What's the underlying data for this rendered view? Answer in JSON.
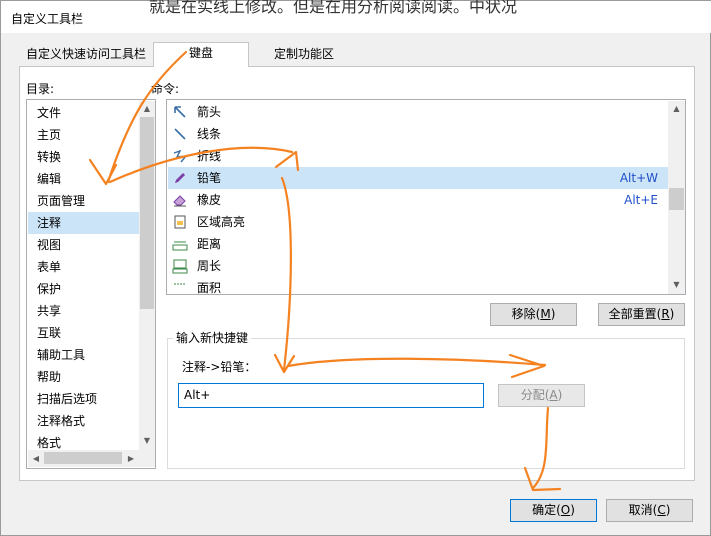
{
  "window": {
    "title": "自定义工具栏",
    "background_text": "就是在实线上修改。但是在用分析阅读阅读。中状况"
  },
  "tabs": [
    {
      "label": "自定义快速访问工具栏",
      "active": false
    },
    {
      "label": "键盘",
      "active": true
    },
    {
      "label": "定制功能区",
      "active": false
    }
  ],
  "directory": {
    "label": "目录:",
    "items": [
      "文件",
      "主页",
      "转换",
      "编辑",
      "页面管理",
      "注释",
      "视图",
      "表单",
      "保护",
      "共享",
      "互联",
      "辅助工具",
      "帮助",
      "扫描后选项",
      "注释格式",
      "格式"
    ],
    "selected": "注释"
  },
  "commands": {
    "label": "命令:",
    "items": [
      {
        "label": "箭头",
        "shortcut": "",
        "icon": "arrow-icon"
      },
      {
        "label": "线条",
        "shortcut": "",
        "icon": "line-icon"
      },
      {
        "label": "折线",
        "shortcut": "",
        "icon": "polyline-icon"
      },
      {
        "label": "铅笔",
        "shortcut": "Alt+W",
        "icon": "pencil-icon"
      },
      {
        "label": "橡皮",
        "shortcut": "Alt+E",
        "icon": "eraser-icon"
      },
      {
        "label": "区域高亮",
        "shortcut": "",
        "icon": "area-highlight-icon"
      },
      {
        "label": "距离",
        "shortcut": "",
        "icon": "distance-icon"
      },
      {
        "label": "周长",
        "shortcut": "",
        "icon": "perimeter-icon"
      },
      {
        "label": "面积",
        "shortcut": "",
        "icon": "area-icon"
      }
    ],
    "selected": "铅笔"
  },
  "buttons": {
    "remove": {
      "label": "移除",
      "mnemonic": "M"
    },
    "reset_all": {
      "label": "全部重置",
      "mnemonic": "R"
    },
    "assign": {
      "label": "分配",
      "mnemonic": "A"
    },
    "ok": {
      "label": "确定",
      "mnemonic": "O"
    },
    "cancel": {
      "label": "取消",
      "mnemonic": "C"
    }
  },
  "new_shortcut": {
    "group_title": "输入新快捷键",
    "current_command": "注释->铅笔：",
    "input_value": "Alt+"
  },
  "colors": {
    "selection": "#cce4f7",
    "shortcut_text": "#1f4fc9",
    "annotation": "#f58220",
    "focus_border": "#0078d7"
  }
}
